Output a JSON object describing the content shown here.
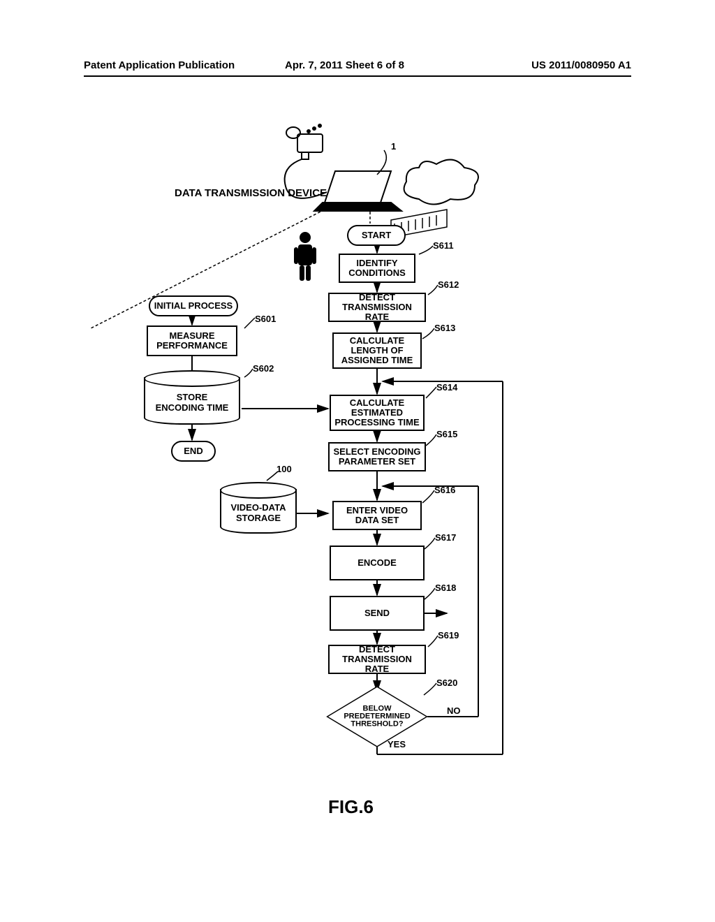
{
  "header": {
    "left": "Patent Application Publication",
    "center": "Apr. 7, 2011   Sheet 6 of 8",
    "right": "US 2011/0080950 A1"
  },
  "diagram": {
    "top_label": "DATA TRANSMISSION DEVICE",
    "device_num": "1",
    "left_flow": {
      "start": "INITIAL PROCESS",
      "s601": "MEASURE\nPERFORMANCE",
      "s601_label": "S601",
      "s602": "STORE\nENCODING TIME",
      "s602_label": "S602",
      "end": "END"
    },
    "storage_num": "100",
    "storage": "VIDEO-DATA\nSTORAGE",
    "right_flow": {
      "start": "START",
      "s611": "IDENTIFY\nCONDITIONS",
      "s611_label": "S611",
      "s612": "DETECT\nTRANSMISSION RATE",
      "s612_label": "S612",
      "s613": "CALCULATE\nLENGTH OF\nASSIGNED TIME",
      "s613_label": "S613",
      "s614": "CALCULATE\nESTIMATED\nPROCESSING TIME",
      "s614_label": "S614",
      "s615": "SELECT ENCODING\nPARAMETER SET",
      "s615_label": "S615",
      "s616": "ENTER VIDEO\nDATA SET",
      "s616_label": "S616",
      "s617": "ENCODE",
      "s617_label": "S617",
      "s618": "SEND",
      "s618_label": "S618",
      "s619": "DETECT\nTRANSMISSION RATE",
      "s619_label": "S619",
      "s620": "BELOW\nPREDETERMINED\nTHRESHOLD?",
      "s620_label": "S620",
      "no": "NO",
      "yes": "YES"
    },
    "figure": "FIG.6"
  }
}
